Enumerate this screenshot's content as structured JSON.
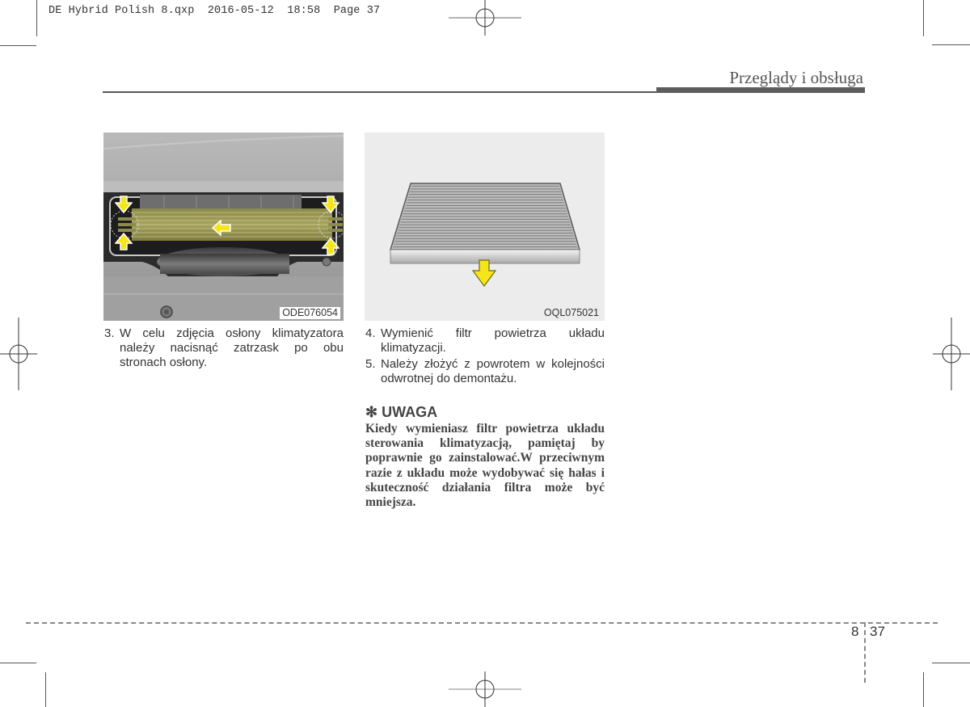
{
  "slug": {
    "file": "DE Hybrid Polish 8.qxp",
    "date": "2016-05-12",
    "time": "18:58",
    "page_label": "Page 37"
  },
  "header": {
    "section_title": "Przeglądy i obsługa"
  },
  "figures": [
    {
      "caption": "ODE076054",
      "description": "Climate control air filter cover with yellow arrows indicating latches on both sides",
      "arrow_color": "#f5e51b"
    },
    {
      "caption": "OQL075021",
      "description": "Climate control air filter with yellow arrow pointing down",
      "arrow_color": "#f5e51b"
    }
  ],
  "steps": [
    {
      "num": "3.",
      "text": "W celu zdjęcia osłony klimatyzatora należy nacisnąć zatrzask po obu stronach osłony."
    },
    {
      "num": "4.",
      "text": "Wymienić filtr powietrza układu klimatyzacji."
    },
    {
      "num": "5.",
      "text": "Należy złożyć z powrotem w kolejności odwrotnej do demontażu."
    }
  ],
  "note": {
    "symbol": "✻",
    "title": "UWAGA",
    "body": "Kiedy wymieniasz filtr powietrza układu sterowania klimatyzacją, pamiętaj by poprawnie go zainstalować.W przeciwnym razie z układu może wydobywać się hałas i skuteczność działania filtra może być mniejsza."
  },
  "footer": {
    "chapter": "8",
    "page": "37"
  }
}
